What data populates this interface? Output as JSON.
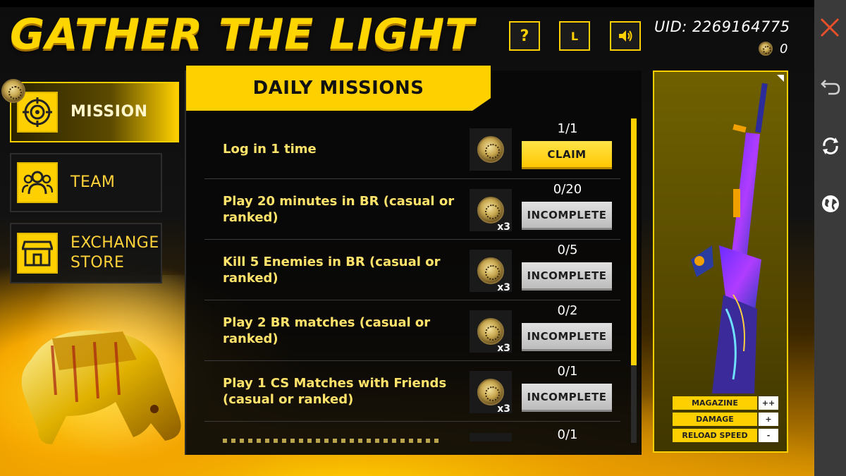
{
  "title": "GATHER THE LIGHT",
  "hud": {
    "help_label": "?",
    "lang_label": "L",
    "uid_text": "UID: 2269164775",
    "coin_count": "0"
  },
  "nav": {
    "mission": "MISSION",
    "team": "TEAM",
    "exchange_store_line1": "EXCHANGE",
    "exchange_store_line2": "STORE"
  },
  "panel": {
    "header": "DAILY MISSIONS",
    "missions": [
      {
        "desc": "Log in 1 time",
        "progress": "1/1",
        "button": "CLAIM",
        "multiplier": ""
      },
      {
        "desc": "Play 20 minutes in BR (casual or ranked)",
        "progress": "0/20",
        "button": "INCOMPLETE",
        "multiplier": "x3"
      },
      {
        "desc": "Kill 5 Enemies in BR (casual or ranked)",
        "progress": "0/5",
        "button": "INCOMPLETE",
        "multiplier": "x3"
      },
      {
        "desc": "Play 2 BR matches (casual or ranked)",
        "progress": "0/2",
        "button": "INCOMPLETE",
        "multiplier": "x3"
      },
      {
        "desc": "Play 1 CS Matches with Friends (casual or ranked)",
        "progress": "0/1",
        "button": "INCOMPLETE",
        "multiplier": "x3"
      },
      {
        "desc": "",
        "progress": "0/1",
        "button": "",
        "multiplier": ""
      }
    ]
  },
  "weapon": {
    "stats": [
      {
        "name": "MAGAZINE",
        "value": "++"
      },
      {
        "name": "DAMAGE",
        "value": "+"
      },
      {
        "name": "RELOAD SPEED",
        "value": "-"
      }
    ]
  },
  "icons": {
    "close": "close-icon",
    "back": "back-icon",
    "refresh": "refresh-icon",
    "globe": "globe-icon"
  },
  "colors": {
    "accent": "#ffd000",
    "close": "#e8502a"
  }
}
